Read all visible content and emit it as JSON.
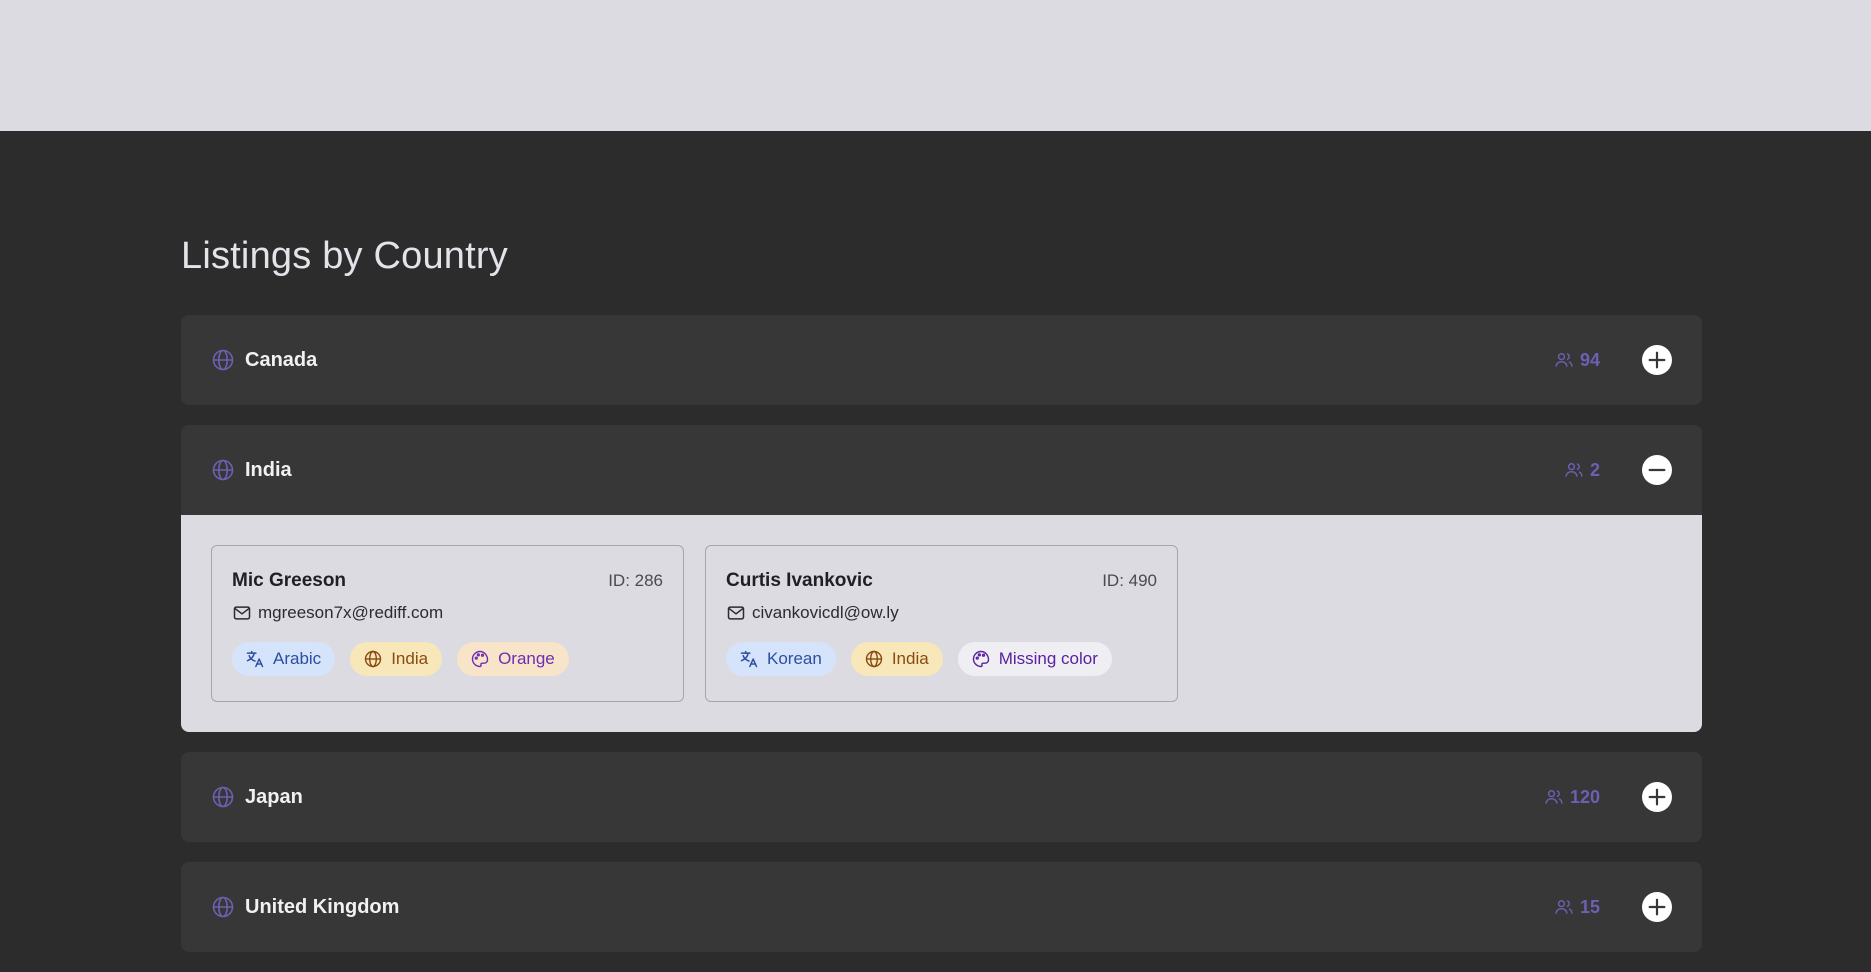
{
  "page": {
    "title": "Listings by Country"
  },
  "colors": {
    "accent": "#6f5fb3",
    "panel_bg": "#373737",
    "page_bg": "#2c2c2c",
    "header_band": "#dcdbe1",
    "expanded_body": "#dcdbe1"
  },
  "countries": [
    {
      "name": "Canada",
      "count": "94",
      "expanded": false,
      "toggle_icon": "plus-circle-icon"
    },
    {
      "name": "India",
      "count": "2",
      "expanded": true,
      "toggle_icon": "minus-circle-icon",
      "listings": [
        {
          "name": "Mic Greeson",
          "id": "ID: 286",
          "email": "mgreeson7x@rediff.com",
          "tags": {
            "language": "Arabic",
            "country": "India",
            "color": "Orange"
          }
        },
        {
          "name": "Curtis Ivankovic",
          "id": "ID: 490",
          "email": "civankovicdl@ow.ly",
          "tags": {
            "language": "Korean",
            "country": "India",
            "color": "Missing color"
          }
        }
      ]
    },
    {
      "name": "Japan",
      "count": "120",
      "expanded": false,
      "toggle_icon": "plus-circle-icon"
    },
    {
      "name": "United Kingdom",
      "count": "15",
      "expanded": false,
      "toggle_icon": "plus-circle-icon"
    }
  ]
}
